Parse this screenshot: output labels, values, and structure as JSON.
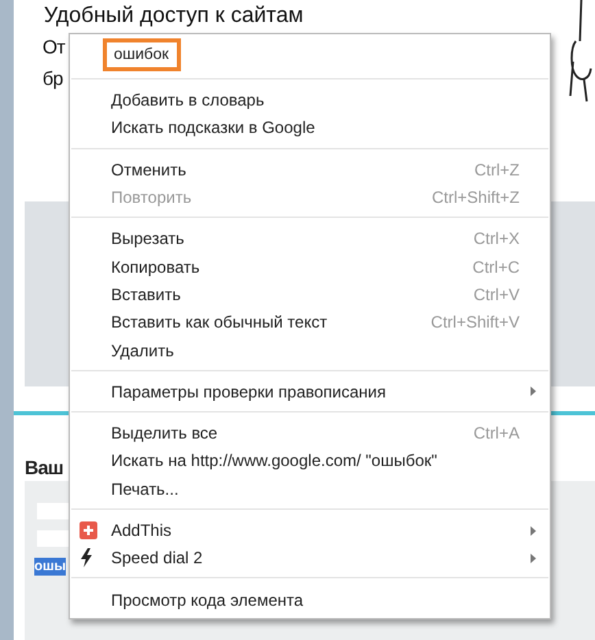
{
  "page": {
    "heading": "Удобный доступ к сайтам",
    "line_2": "От",
    "line_3": "бр",
    "section_title": "Ваш",
    "selected_text": "ошы"
  },
  "context_menu": {
    "sections": [
      {
        "items": [
          {
            "kind": "suggestion",
            "label": "ошибок"
          }
        ]
      },
      {
        "items": [
          {
            "kind": "command",
            "label": "Добавить в словарь",
            "disabled": false,
            "submenu": false
          },
          {
            "kind": "command",
            "label": "Искать подсказки в Google",
            "disabled": false,
            "submenu": false
          }
        ]
      },
      {
        "items": [
          {
            "kind": "command",
            "label": "Отменить",
            "shortcut": "Ctrl+Z",
            "disabled": false,
            "submenu": false
          },
          {
            "kind": "command",
            "label": "Повторить",
            "shortcut": "Ctrl+Shift+Z",
            "disabled": true,
            "submenu": false
          }
        ]
      },
      {
        "items": [
          {
            "kind": "command",
            "label": "Вырезать",
            "shortcut": "Ctrl+X",
            "disabled": false,
            "submenu": false
          },
          {
            "kind": "command",
            "label": "Копировать",
            "shortcut": "Ctrl+C",
            "disabled": false,
            "submenu": false
          },
          {
            "kind": "command",
            "label": "Вставить",
            "shortcut": "Ctrl+V",
            "disabled": false,
            "submenu": false
          },
          {
            "kind": "command",
            "label": "Вставить как обычный текст",
            "shortcut": "Ctrl+Shift+V",
            "disabled": false,
            "submenu": false
          },
          {
            "kind": "command",
            "label": "Удалить",
            "disabled": false,
            "submenu": false
          }
        ]
      },
      {
        "items": [
          {
            "kind": "command",
            "label": "Параметры проверки правописания",
            "disabled": false,
            "submenu": true
          }
        ]
      },
      {
        "items": [
          {
            "kind": "command",
            "label": "Выделить все",
            "shortcut": "Ctrl+A",
            "disabled": false,
            "submenu": false
          },
          {
            "kind": "command",
            "label": "Искать на  http://www.google.com/ \"ошыбок\"",
            "disabled": false,
            "submenu": false
          },
          {
            "kind": "command",
            "label": "Печать...",
            "disabled": false,
            "submenu": false
          }
        ]
      },
      {
        "items": [
          {
            "kind": "plus",
            "label": "AddThis",
            "disabled": false,
            "submenu": true
          },
          {
            "kind": "bolt",
            "label": "Speed dial 2",
            "disabled": false,
            "submenu": true
          }
        ]
      },
      {
        "items": [
          {
            "kind": "command",
            "label": "Просмотр кода элемента",
            "disabled": false,
            "submenu": false
          }
        ]
      }
    ]
  }
}
